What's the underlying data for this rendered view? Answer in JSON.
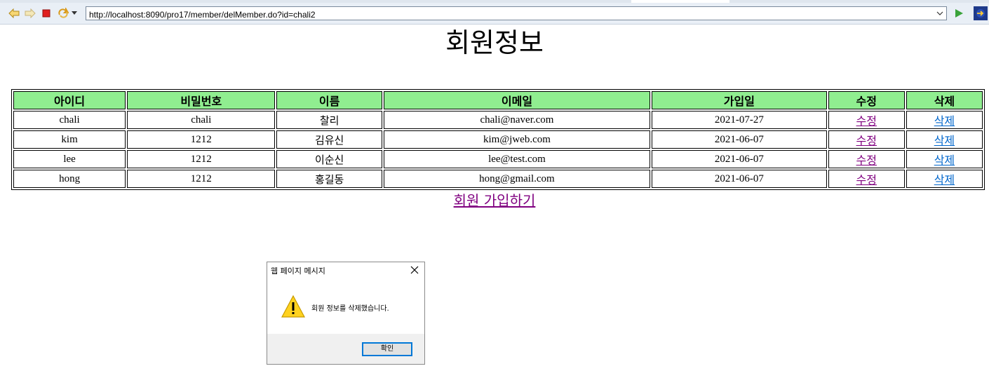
{
  "browser": {
    "url": "http://localhost:8090/pro17/member/delMember.do?id=chali2",
    "icons": [
      "back-icon",
      "forward-icon",
      "stop-icon",
      "refresh-icon",
      "menu-dropdown-icon",
      "go-icon",
      "eclipse-icon"
    ]
  },
  "page": {
    "title": "회원정보",
    "table": {
      "headers": [
        "아이디",
        "비밀번호",
        "이름",
        "이메일",
        "가입일",
        "수정",
        "삭제"
      ],
      "rows": [
        {
          "id": "chali",
          "pwd": "chali",
          "name": "찰리",
          "email": "chali@naver.com",
          "joinDate": "2021-07-27",
          "edit": "수정",
          "del": "삭제"
        },
        {
          "id": "kim",
          "pwd": "1212",
          "name": "김유신",
          "email": "kim@jweb.com",
          "joinDate": "2021-06-07",
          "edit": "수정",
          "del": "삭제"
        },
        {
          "id": "lee",
          "pwd": "1212",
          "name": "이순신",
          "email": "lee@test.com",
          "joinDate": "2021-06-07",
          "edit": "수정",
          "del": "삭제"
        },
        {
          "id": "hong",
          "pwd": "1212",
          "name": "홍길동",
          "email": "hong@gmail.com",
          "joinDate": "2021-06-07",
          "edit": "수정",
          "del": "삭제"
        }
      ]
    },
    "join_link": "회원 가입하기"
  },
  "dialog": {
    "title": "웹 페이지 메시지",
    "message": "회원 정보를 삭제했습니다.",
    "ok_label": "확인",
    "icon": "warning-icon"
  },
  "colors": {
    "header_bg": "#90ee90",
    "visited_link": "#800080",
    "link": "#0066cc",
    "dialog_ok_border": "#0078d7"
  }
}
